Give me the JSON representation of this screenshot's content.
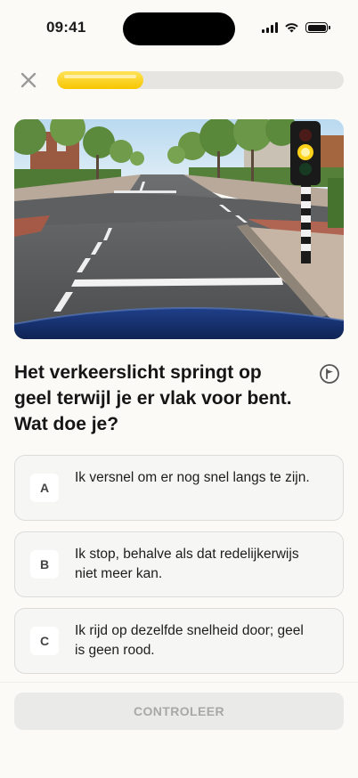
{
  "status_bar": {
    "time": "09:41"
  },
  "header": {
    "progress_fraction": 0.3
  },
  "question": {
    "text": "Het verkeerslicht springt op geel terwijl je er vlak voor bent. Wat doe je?"
  },
  "answers": [
    {
      "letter": "A",
      "text": "Ik versnel om er nog snel langs te zijn."
    },
    {
      "letter": "B",
      "text": "Ik stop, behalve als dat redelijkerwijs niet meer kan."
    },
    {
      "letter": "C",
      "text": "Ik rijd op dezelfde snelheid door; geel is geen rood."
    }
  ],
  "footer": {
    "check_label": "CONTROLEER"
  },
  "colors": {
    "accent": "#f7c600",
    "background": "#fbfaf6",
    "traffic_light_active": "#ffd21a"
  },
  "icons": {
    "close": "close-icon",
    "flag": "flag-icon",
    "signal": "signal-icon",
    "wifi": "wifi-icon",
    "battery": "battery-icon"
  }
}
